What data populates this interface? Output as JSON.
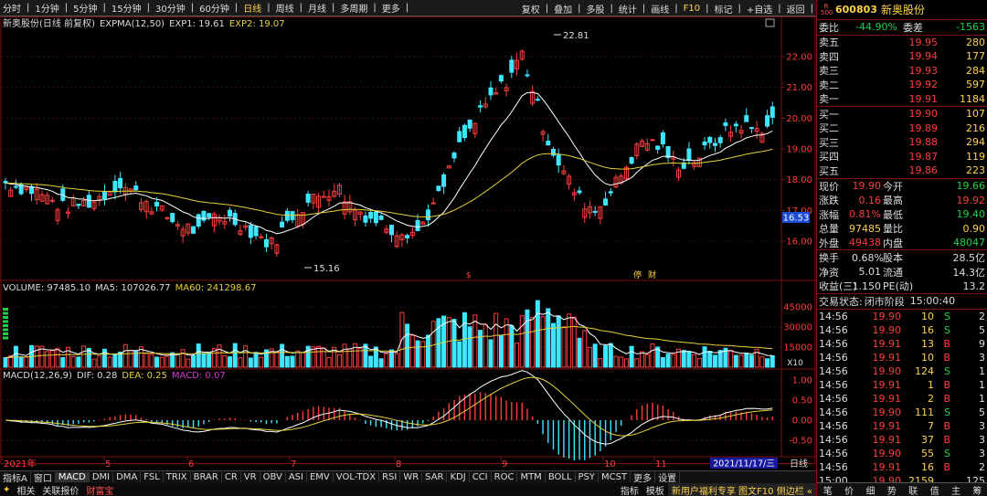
{
  "toolbar": {
    "periods": [
      "分时",
      "1分钟",
      "5分钟",
      "15分钟",
      "30分钟",
      "60分钟",
      "日线",
      "周线",
      "月线",
      "多周期",
      "更多"
    ],
    "active_period": "日线",
    "functions": [
      "复权",
      "叠加",
      "多股",
      "统计",
      "画线",
      "F10",
      "标记",
      "+自选",
      "返回"
    ],
    "highlight_function": "F10"
  },
  "main_chart": {
    "legend_name": "新奥股份(日线 前复权)",
    "legend_indicator": "EXPMA(12,50)",
    "exp1": "EXP1: 19.61",
    "exp2": "EXP2: 19.07",
    "y_ticks": [
      "22.00",
      "21.00",
      "20.00",
      "19.00",
      "18.00",
      "17.00",
      "16.00"
    ],
    "current_price_tag": "16.53",
    "high_annotation": "22.81",
    "low_annotation": "15.16",
    "event_markers": [
      "$",
      "停",
      "财"
    ]
  },
  "volume_chart": {
    "legend_name": "VOLUME: 97485.10",
    "ma5": "MA5: 107026.77",
    "ma60": "MA60: 241298.67",
    "y_ticks": [
      "45000",
      "30000",
      "15000"
    ],
    "unit": "X10"
  },
  "macd_chart": {
    "legend_name": "MACD(12,26,9)",
    "dif": "DIF: 0.28",
    "dea": "DEA: 0.25",
    "macd": "MACD: 0.07",
    "y_ticks": [
      "1.00",
      "0.50",
      "0.00",
      "-0.50"
    ]
  },
  "x_axis": {
    "labels": [
      "2021年",
      "5",
      "6",
      "7",
      "8",
      "9",
      "10",
      "11"
    ],
    "date_box": "2021/11/17/三",
    "period_label": "日线"
  },
  "indicator_tabs": [
    "指标A",
    "窗口",
    "MACD",
    "DMI",
    "DMA",
    "FSL",
    "TRIX",
    "BRAR",
    "CR",
    "VR",
    "OBV",
    "ASI",
    "EMV",
    "VOL-TDX",
    "RSI",
    "WR",
    "SAR",
    "KDJ",
    "CCI",
    "ROC",
    "MTM",
    "BOLL",
    "PSY",
    "MCST",
    "更多",
    "设置"
  ],
  "active_indicator": "MACD",
  "bottom_bar": {
    "items": [
      "相关",
      "关联报价",
      "财富宝"
    ],
    "right_links": [
      "指标",
      "模板"
    ],
    "promo": "新用户福利专享 图文F10 侧边栏 «"
  },
  "quote": {
    "badge_top": "R",
    "badge_bottom": "500",
    "code": "600803",
    "name": "新奥股份",
    "wei_bi_label": "委比",
    "wei_bi_value": "-44.90%",
    "wei_cha_label": "委差",
    "wei_cha_value": "-1563",
    "asks": [
      {
        "label": "卖五",
        "price": "19.95",
        "vol": "280"
      },
      {
        "label": "卖四",
        "price": "19.94",
        "vol": "177"
      },
      {
        "label": "卖三",
        "price": "19.93",
        "vol": "284"
      },
      {
        "label": "卖二",
        "price": "19.92",
        "vol": "597"
      },
      {
        "label": "卖一",
        "price": "19.91",
        "vol": "1184"
      }
    ],
    "bids": [
      {
        "label": "买一",
        "price": "19.90",
        "vol": "107"
      },
      {
        "label": "买二",
        "price": "19.89",
        "vol": "216"
      },
      {
        "label": "买三",
        "price": "19.88",
        "vol": "294"
      },
      {
        "label": "买四",
        "price": "19.87",
        "vol": "119"
      },
      {
        "label": "买五",
        "price": "19.86",
        "vol": "223"
      }
    ],
    "stats": [
      {
        "l1": "现价",
        "v1": "19.90",
        "c1": "red",
        "l2": "今开",
        "v2": "19.66",
        "c2": "grn"
      },
      {
        "l1": "涨跌",
        "v1": "0.16",
        "c1": "red",
        "l2": "最高",
        "v2": "19.92",
        "c2": "red"
      },
      {
        "l1": "涨幅",
        "v1": "0.81%",
        "c1": "red",
        "l2": "最低",
        "v2": "19.40",
        "c2": "grn"
      },
      {
        "l1": "总量",
        "v1": "97485",
        "c1": "yel",
        "l2": "量比",
        "v2": "0.90",
        "c2": "yel"
      },
      {
        "l1": "外盘",
        "v1": "49438",
        "c1": "red",
        "l2": "内盘",
        "v2": "48047",
        "c2": "grn"
      }
    ],
    "stats2": [
      {
        "l1": "换手",
        "v1": "0.68%",
        "l2": "股本",
        "v2": "28.5亿"
      },
      {
        "l1": "净资",
        "v1": "5.01",
        "l2": "流通",
        "v2": "14.3亿"
      },
      {
        "l1": "收益(三)",
        "v1": "1.150",
        "l2": "PE(动)",
        "v2": "13.2"
      }
    ],
    "status_label": "交易状态:",
    "status_value": "闭市阶段",
    "status_time": "15:00:40",
    "ticks": [
      {
        "t": "14:56",
        "p": "19.90",
        "pc": "red",
        "v": "10",
        "d": "S",
        "dc": "grn",
        "n": "2"
      },
      {
        "t": "14:56",
        "p": "19.90",
        "pc": "red",
        "v": "16",
        "d": "S",
        "dc": "grn",
        "n": "5"
      },
      {
        "t": "14:56",
        "p": "19.91",
        "pc": "red",
        "v": "13",
        "d": "B",
        "dc": "red",
        "n": "9"
      },
      {
        "t": "14:56",
        "p": "19.91",
        "pc": "red",
        "v": "10",
        "d": "B",
        "dc": "red",
        "n": "3"
      },
      {
        "t": "14:56",
        "p": "19.90",
        "pc": "red",
        "v": "124",
        "d": "S",
        "dc": "grn",
        "n": "1"
      },
      {
        "t": "14:56",
        "p": "19.91",
        "pc": "red",
        "v": "1",
        "d": "B",
        "dc": "red",
        "n": "1"
      },
      {
        "t": "14:56",
        "p": "19.91",
        "pc": "red",
        "v": "2",
        "d": "B",
        "dc": "red",
        "n": "1"
      },
      {
        "t": "14:56",
        "p": "19.90",
        "pc": "red",
        "v": "111",
        "d": "S",
        "dc": "grn",
        "n": "5"
      },
      {
        "t": "14:56",
        "p": "19.91",
        "pc": "red",
        "v": "7",
        "d": "B",
        "dc": "red",
        "n": "3"
      },
      {
        "t": "14:56",
        "p": "19.91",
        "pc": "red",
        "v": "37",
        "d": "B",
        "dc": "red",
        "n": "3"
      },
      {
        "t": "14:56",
        "p": "19.90",
        "pc": "red",
        "v": "55",
        "d": "S",
        "dc": "grn",
        "n": "3"
      },
      {
        "t": "14:56",
        "p": "19.91",
        "pc": "red",
        "v": "16",
        "d": "B",
        "dc": "red",
        "n": "2"
      },
      {
        "t": "15:00",
        "p": "19.90",
        "pc": "red",
        "v": "2159",
        "d": "",
        "dc": "red",
        "n": "125"
      }
    ],
    "tabs": [
      "笔",
      "价",
      "细",
      "势",
      "联",
      "值",
      "主",
      "筹"
    ]
  },
  "colors": {
    "up": "#ff3c3c",
    "down": "#3ee6ff",
    "exp1": "#ffffff",
    "exp2": "#e6d23a",
    "frame": "#7a1111",
    "grid": "#3a1010"
  }
}
